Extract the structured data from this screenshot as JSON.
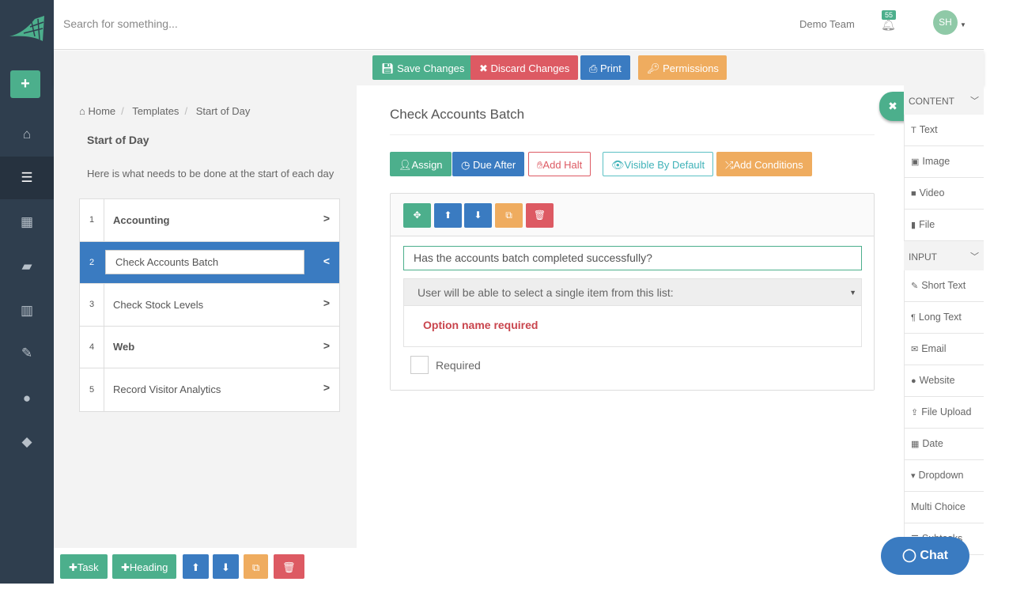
{
  "header": {
    "search_placeholder": "Search for something...",
    "team": "Demo Team",
    "notifications": "55",
    "avatar_initials": "SH"
  },
  "toolbar": {
    "save": "Save Changes",
    "discard": "Discard Changes",
    "print": "Print",
    "permissions": "Permissions"
  },
  "breadcrumb": [
    "Home",
    "Templates",
    "Start of Day"
  ],
  "template": {
    "title": "Start of Day",
    "description": "Here is what needs to be done at the start of each day"
  },
  "tasks": [
    {
      "num": "1",
      "label": "Accounting",
      "heading": true
    },
    {
      "num": "2",
      "label": "Check Accounts Batch",
      "selected": true
    },
    {
      "num": "3",
      "label": "Check Stock Levels"
    },
    {
      "num": "4",
      "label": "Web",
      "heading": true
    },
    {
      "num": "5",
      "label": "Record Visitor Analytics"
    }
  ],
  "bottom": {
    "task": "Task",
    "heading": "Heading"
  },
  "task_detail": {
    "title": "Check Accounts Batch",
    "assign": "Assign",
    "due_after": "Due After",
    "add_halt": "Add Halt",
    "visible": "Visible By Default",
    "conditions": "Add Conditions",
    "question": "Has the accounts batch completed successfully?",
    "select_hint": "User will be able to select a single item from this list:",
    "error": "Option name required",
    "required": "Required"
  },
  "palette": {
    "content_header": "CONTENT",
    "content": [
      "Text",
      "Image",
      "Video",
      "File"
    ],
    "input_header": "INPUT",
    "input": [
      "Short Text",
      "Long Text",
      "Email",
      "Website",
      "File Upload",
      "Date",
      "Dropdown",
      "Multi Choice",
      "Subtasks"
    ]
  },
  "chat": "Chat",
  "colors": {
    "green": "#4caf8c",
    "red": "#dd5a63",
    "blue": "#3a7bc1",
    "orange": "#efac5f",
    "sidebar": "#2f3e4e"
  }
}
